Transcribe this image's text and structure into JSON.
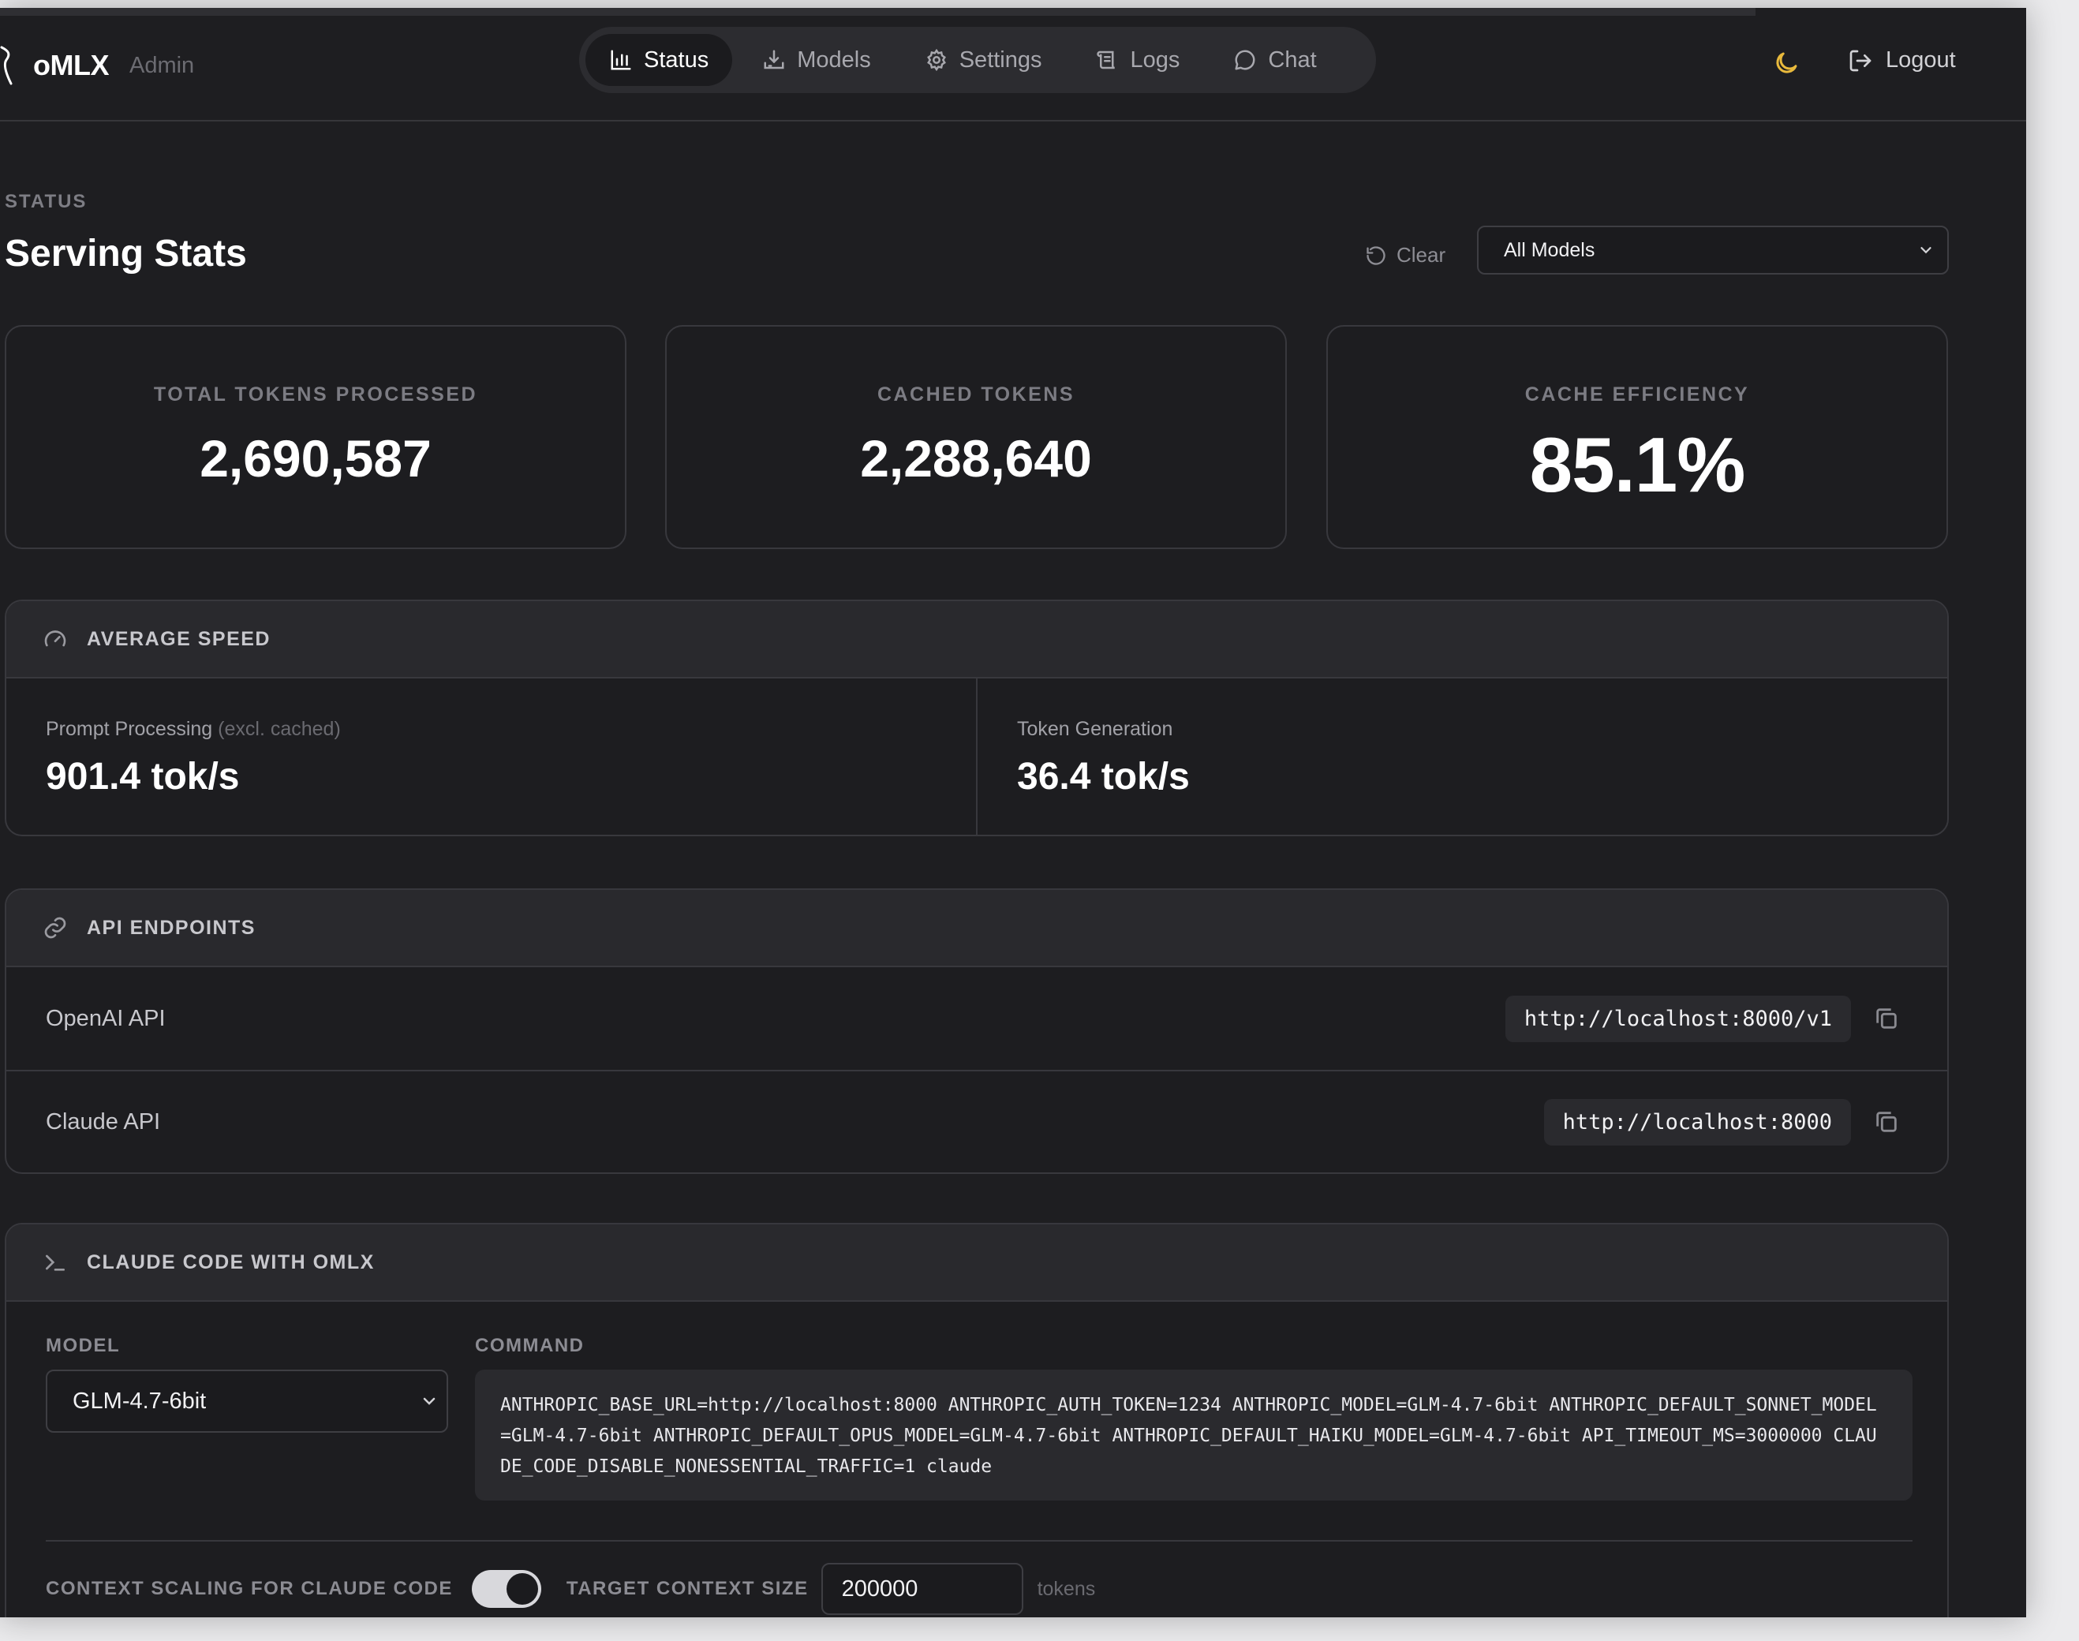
{
  "brand": {
    "name": "oMLX",
    "subtitle": "Admin"
  },
  "nav": {
    "items": [
      {
        "label": "Status",
        "icon": "bar-chart-icon",
        "active": true
      },
      {
        "label": "Models",
        "icon": "download-icon",
        "active": false
      },
      {
        "label": "Settings",
        "icon": "gear-icon",
        "active": false
      },
      {
        "label": "Logs",
        "icon": "scroll-icon",
        "active": false
      },
      {
        "label": "Chat",
        "icon": "chat-bubble-icon",
        "active": false
      }
    ]
  },
  "header": {
    "theme_icon": "moon-icon",
    "logout_label": "Logout"
  },
  "page": {
    "eyebrow": "STATUS",
    "title": "Serving Stats",
    "clear_label": "Clear",
    "model_filter": "All Models"
  },
  "stats": [
    {
      "label": "TOTAL TOKENS PROCESSED",
      "value": "2,690,587"
    },
    {
      "label": "CACHED TOKENS",
      "value": "2,288,640"
    },
    {
      "label": "CACHE EFFICIENCY",
      "value": "85.1%"
    }
  ],
  "speed": {
    "title": "AVERAGE SPEED",
    "prompt_label": "Prompt Processing",
    "prompt_note": "(excl. cached)",
    "prompt_value": "901.4 tok/s",
    "gen_label": "Token Generation",
    "gen_value": "36.4 tok/s"
  },
  "endpoints": {
    "title": "API ENDPOINTS",
    "items": [
      {
        "label": "OpenAI API",
        "url": "http://localhost:8000/v1"
      },
      {
        "label": "Claude API",
        "url": "http://localhost:8000"
      }
    ]
  },
  "claude_code": {
    "title": "CLAUDE CODE WITH OMLX",
    "model_label": "MODEL",
    "model_value": "GLM-4.7-6bit",
    "command_label": "COMMAND",
    "command": "ANTHROPIC_BASE_URL=http://localhost:8000 ANTHROPIC_AUTH_TOKEN=1234 ANTHROPIC_MODEL=GLM-4.7-6bit ANTHROPIC_DEFAULT_SONNET_MODEL=GLM-4.7-6bit ANTHROPIC_DEFAULT_OPUS_MODEL=GLM-4.7-6bit ANTHROPIC_DEFAULT_HAIKU_MODEL=GLM-4.7-6bit API_TIMEOUT_MS=3000000 CLAUDE_CODE_DISABLE_NONESSENTIAL_TRAFFIC=1 claude",
    "scaling_label": "CONTEXT SCALING FOR CLAUDE CODE",
    "scaling_enabled": true,
    "target_label": "TARGET CONTEXT SIZE",
    "target_value": "200000",
    "target_unit": "tokens"
  },
  "colors": {
    "background": "#1e1e21",
    "accent_moon": "#e8b93c",
    "panel_header": "#29292d"
  }
}
